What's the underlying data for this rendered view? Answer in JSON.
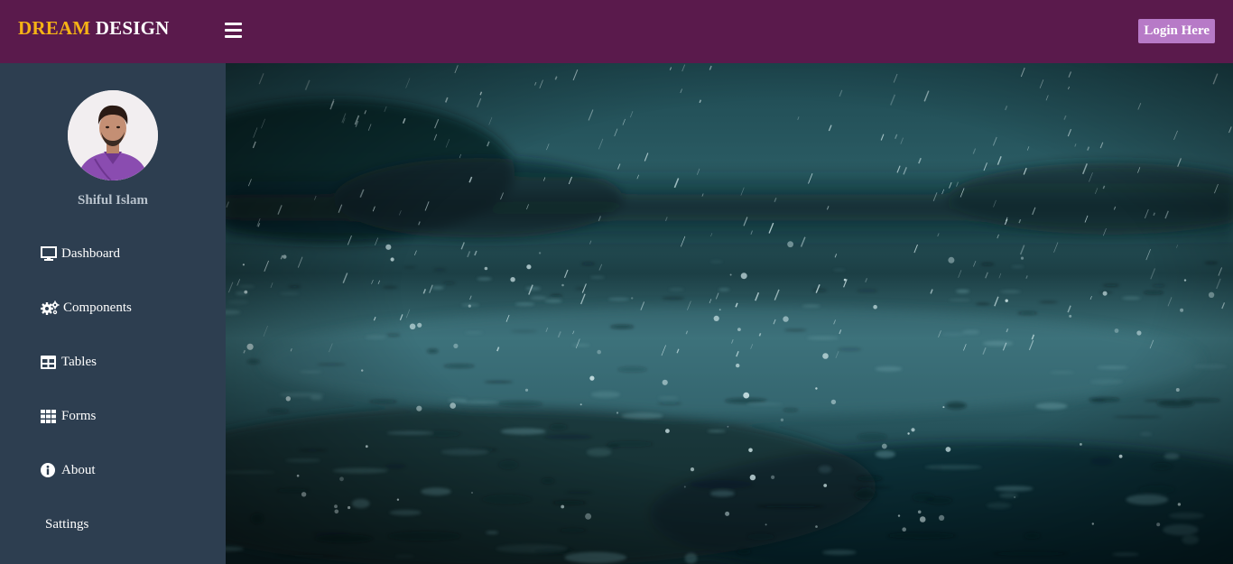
{
  "header": {
    "brand_part1": "DREAM",
    "brand_part2": "DESIGN",
    "login_label": "Login Here"
  },
  "colors": {
    "header_bg": "#5a1a4c",
    "brand_accent": "#f5b315",
    "sidebar_bg": "#2d3e50",
    "login_bg": "#b77ac7"
  },
  "profile": {
    "name": "Shiful Islam"
  },
  "sidebar": {
    "items": [
      {
        "label": "Dashboard",
        "icon": "monitor-icon"
      },
      {
        "label": "Components",
        "icon": "gears-icon"
      },
      {
        "label": "Tables",
        "icon": "table-icon"
      },
      {
        "label": "Forms",
        "icon": "grid-icon"
      },
      {
        "label": "About",
        "icon": "info-icon"
      },
      {
        "label": "Sattings",
        "icon": ""
      }
    ]
  }
}
